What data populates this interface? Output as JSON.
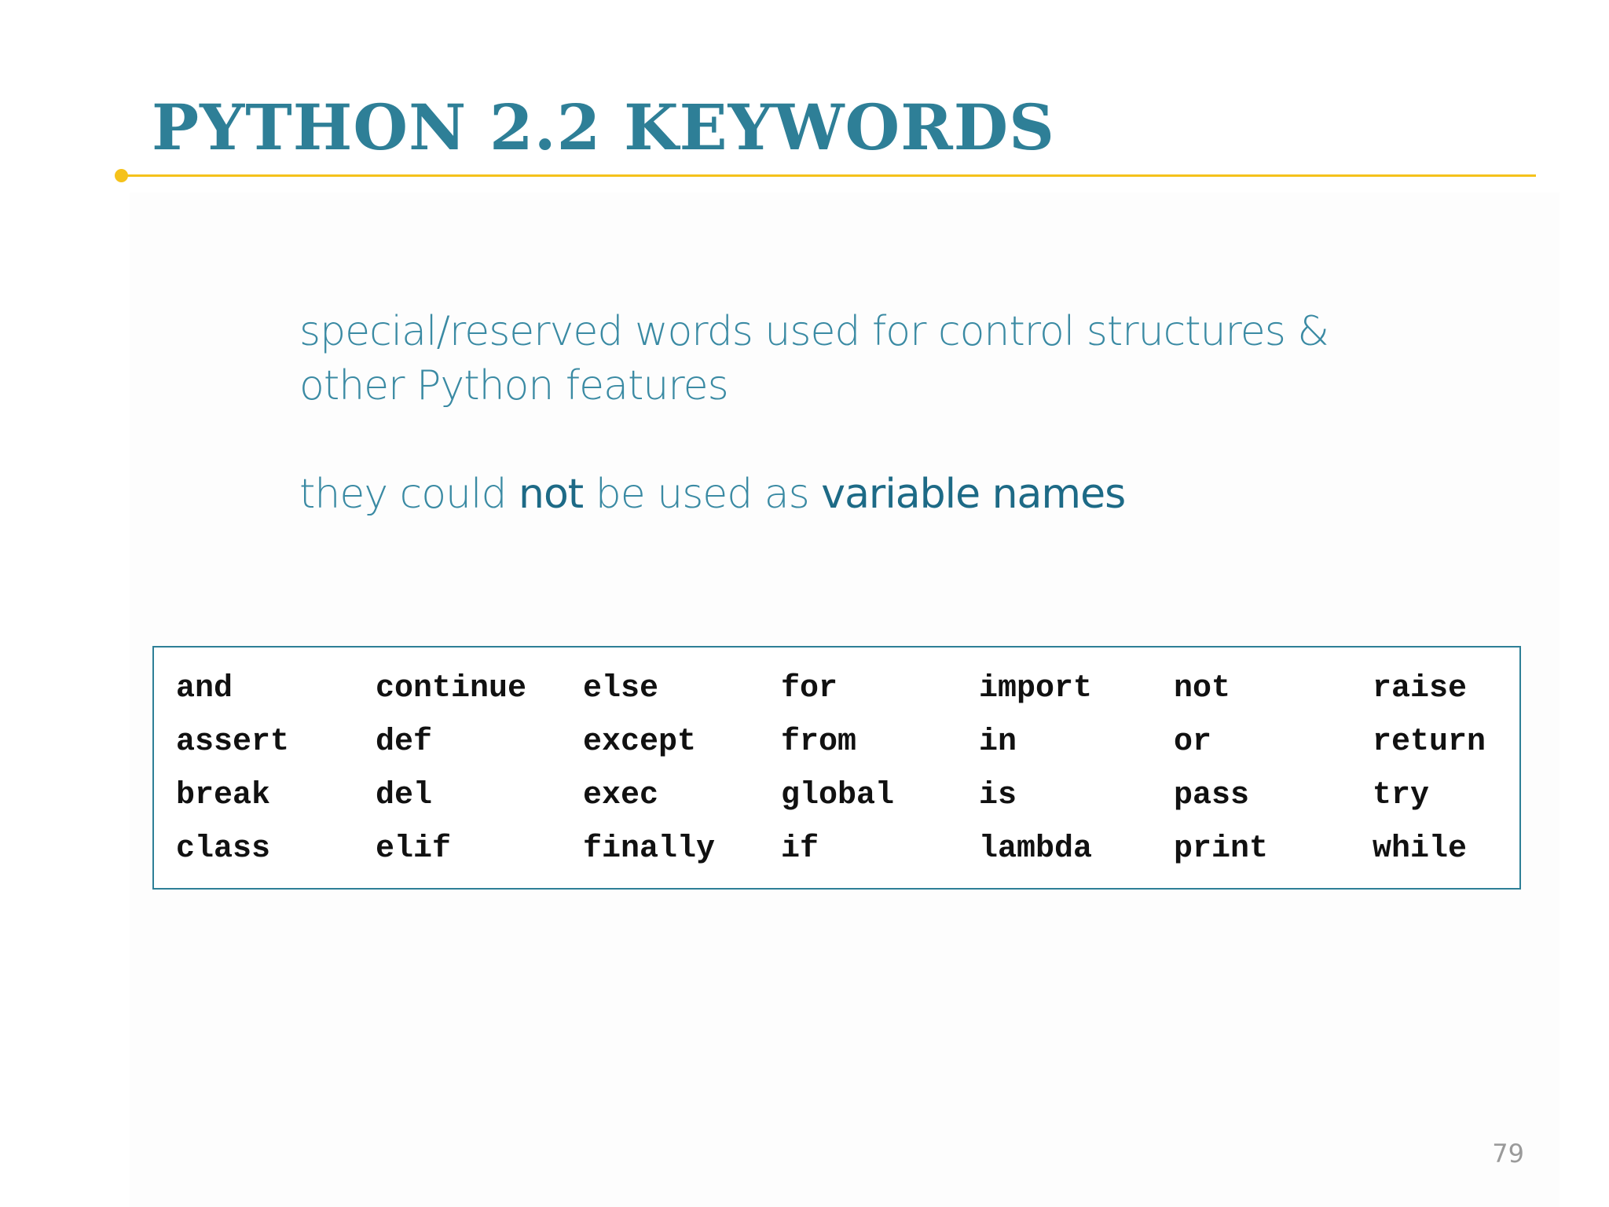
{
  "slide": {
    "title": "PYTHON 2.2 KEYWORDS",
    "body": {
      "line1": "special/reserved words used for control structures &",
      "line2": "other Python features",
      "line3_pre": "they could ",
      "line3_em1": "not",
      "line3_mid": " be used as ",
      "line3_em2": "variable names"
    },
    "keywords": [
      [
        "and",
        "continue",
        "else",
        "for",
        "import",
        "not",
        "raise"
      ],
      [
        "assert",
        "def",
        "except",
        "from",
        "in",
        "or",
        "return"
      ],
      [
        "break",
        "del",
        "exec",
        "global",
        "is",
        "pass",
        "try"
      ],
      [
        "class",
        "elif",
        "finally",
        "if",
        "lambda",
        "print",
        "while"
      ]
    ],
    "page_number": "79"
  },
  "colors": {
    "title": "#2e7f97",
    "accent_rule": "#f5c21b",
    "body_text": "#3a8aa3",
    "body_emphasis": "#1d6a86",
    "table_border": "#2e7f97",
    "page_number": "#9a9a9a"
  }
}
